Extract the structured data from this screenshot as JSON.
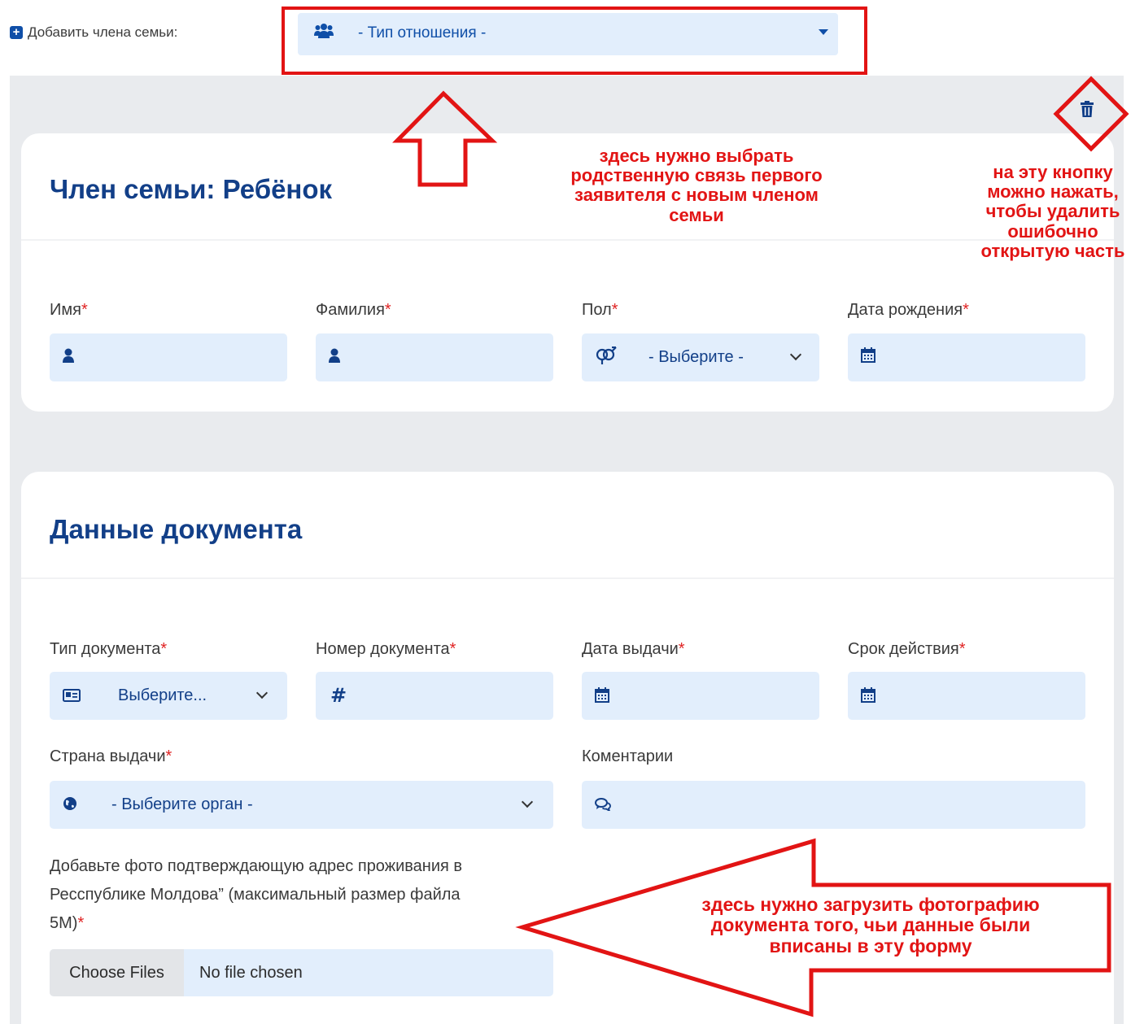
{
  "add_member": {
    "label": "Добавить члена семьи:",
    "relation_select": {
      "value": "- Тип отношения -"
    }
  },
  "member_card": {
    "title": "Член семьи: Ребёнок",
    "fields": {
      "first_name": {
        "label": "Имя",
        "value": ""
      },
      "last_name": {
        "label": "Фамилия",
        "value": ""
      },
      "gender": {
        "label": "Пол",
        "value": "- Выберите -"
      },
      "birth_date": {
        "label": "Дата рождения",
        "value": ""
      }
    }
  },
  "document_card": {
    "title": "Данные документа",
    "fields": {
      "doc_type": {
        "label": "Тип документа",
        "value": "Выберите..."
      },
      "doc_number": {
        "label": "Номер документа",
        "value": ""
      },
      "issue_date": {
        "label": "Дата выдачи",
        "value": ""
      },
      "expiry": {
        "label": "Срок действия",
        "value": ""
      },
      "country": {
        "label": "Страна выдачи",
        "value": "- Выберите орган -"
      },
      "comments": {
        "label": "Коментарии",
        "value": ""
      }
    },
    "upload": {
      "label_line1": "Добавьте фото подтверждающую адрес проживания в",
      "label_line2": "Ресспублике Молдова” (максимальный размер файла",
      "label_line3": "5M)",
      "button_label": "Choose Files",
      "status": "No file chosen"
    }
  },
  "required_marker": "*",
  "annotations": {
    "relation_note": [
      "здесь нужно выбрать",
      "родственную связь первого",
      "заявителя с новым членом",
      "семьи"
    ],
    "delete_note": [
      "на эту кнопку",
      "можно нажать,",
      "чтобы удалить",
      "ошибочно",
      "открытую часть"
    ],
    "upload_note": [
      "здесь нужно загрузить фотографию",
      "документа того, чьи данные были",
      "вписаны в эту форму"
    ]
  },
  "colors": {
    "accent": "#0f4fa8",
    "title": "#123f88",
    "field_bg": "#e2eefc",
    "annotation": "#e21414",
    "page_bg": "#e9ebee"
  },
  "icons": [
    "plus-square-icon",
    "users-icon",
    "user-icon",
    "gender-icon",
    "calendar-icon",
    "id-card-icon",
    "hash-icon",
    "globe-icon",
    "comments-icon",
    "trash-icon"
  ]
}
